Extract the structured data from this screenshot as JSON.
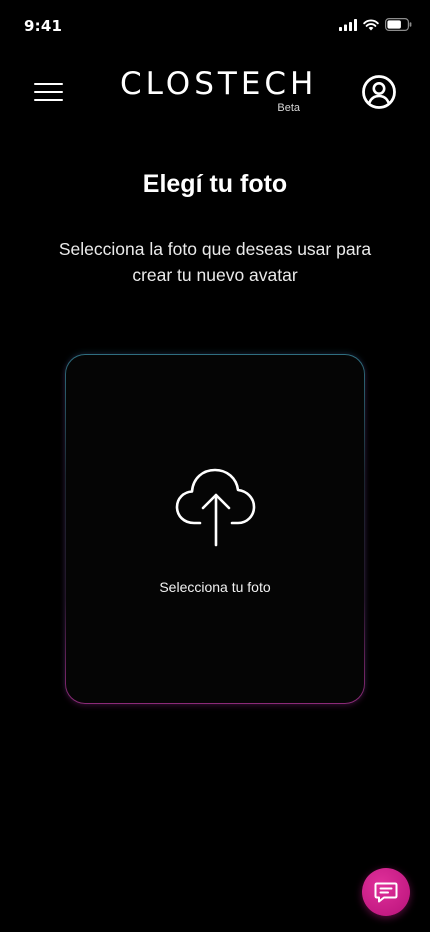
{
  "status_bar": {
    "time": "9:41",
    "icons": [
      "signal-icon",
      "wifi-icon",
      "battery-icon"
    ]
  },
  "header": {
    "menu_icon": "hamburger-menu-icon",
    "logo_text": "CLOSTECH",
    "logo_badge": "Beta",
    "profile_icon": "user-circle-icon"
  },
  "main": {
    "title": "Elegí tu foto",
    "subtitle": "Selecciona la foto que deseas usar para crear tu nuevo avatar",
    "upload": {
      "icon": "cloud-upload-icon",
      "label": "Selecciona tu foto"
    }
  },
  "chat_button": {
    "icon": "chat-icon"
  },
  "colors": {
    "background": "#000000",
    "text": "#ffffff",
    "accent_magenta": "#c81a86",
    "card_border_top": "#2f6f80",
    "card_border_bottom": "#8c2a78"
  }
}
